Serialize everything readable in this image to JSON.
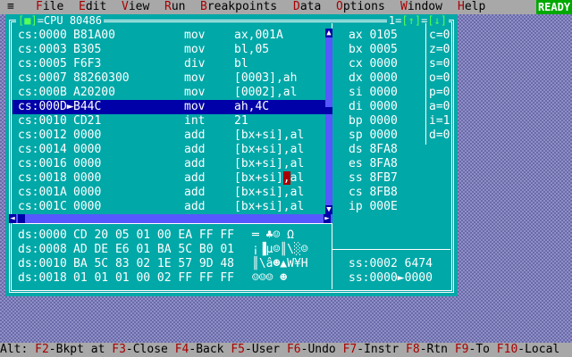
{
  "menubar": {
    "system_icon": "≡",
    "items": [
      {
        "hotkey": "F",
        "rest": "ile"
      },
      {
        "hotkey": "E",
        "rest": "dit"
      },
      {
        "hotkey": "V",
        "rest": "iew"
      },
      {
        "hotkey": "R",
        "rest": "un"
      },
      {
        "hotkey": "B",
        "rest": "reakpoints"
      },
      {
        "hotkey": "D",
        "rest": "ata"
      },
      {
        "hotkey": "O",
        "rest": "ptions"
      },
      {
        "hotkey": "W",
        "rest": "indow"
      },
      {
        "hotkey": "H",
        "rest": "elp"
      }
    ],
    "status": "READY"
  },
  "window": {
    "close_button": "[■]",
    "title": "CPU 80486",
    "number": "1",
    "zoom_button": "[↑]",
    "resize_button": "[↓]"
  },
  "disassembly": [
    {
      "addr": "cs:0000",
      "bytes": "B81A00",
      "mnemonic": "mov",
      "operands": "ax,001A"
    },
    {
      "addr": "cs:0003",
      "bytes": "B305",
      "mnemonic": "mov",
      "operands": "bl,05"
    },
    {
      "addr": "cs:0005",
      "bytes": "F6F3",
      "mnemonic": "div",
      "operands": "bl"
    },
    {
      "addr": "cs:0007",
      "bytes": "88260300",
      "mnemonic": "mov",
      "operands": "[0003],ah"
    },
    {
      "addr": "cs:000B",
      "bytes": "A20200",
      "mnemonic": "mov",
      "operands": "[0002],al"
    },
    {
      "addr": "cs:000D",
      "bytes": "B44C",
      "mnemonic": "mov",
      "operands": "ah,4C",
      "marker": "►",
      "selected": true
    },
    {
      "addr": "cs:0010",
      "bytes": "CD21",
      "mnemonic": "int",
      "operands": "21"
    },
    {
      "addr": "cs:0012",
      "bytes": "0000",
      "mnemonic": "add",
      "operands": "[bx+si],al"
    },
    {
      "addr": "cs:0014",
      "bytes": "0000",
      "mnemonic": "add",
      "operands": "[bx+si],al"
    },
    {
      "addr": "cs:0016",
      "bytes": "0000",
      "mnemonic": "add",
      "operands": "[bx+si],al"
    },
    {
      "addr": "cs:0018",
      "bytes": "0000",
      "mnemonic": "add",
      "operands_before": "[bx+si]",
      "cursor_char": ",",
      "operands_after": "al"
    },
    {
      "addr": "cs:001A",
      "bytes": "0000",
      "mnemonic": "add",
      "operands": "[bx+si],al"
    },
    {
      "addr": "cs:001C",
      "bytes": "0000",
      "mnemonic": "add",
      "operands": "[bx+si],al"
    }
  ],
  "registers": [
    {
      "name": "ax",
      "value": "0105"
    },
    {
      "name": "bx",
      "value": "0005"
    },
    {
      "name": "cx",
      "value": "0000"
    },
    {
      "name": "dx",
      "value": "0000"
    },
    {
      "name": "si",
      "value": "0000"
    },
    {
      "name": "di",
      "value": "0000"
    },
    {
      "name": "bp",
      "value": "0000"
    },
    {
      "name": "sp",
      "value": "0000"
    },
    {
      "name": "ds",
      "value": "8FA8"
    },
    {
      "name": "es",
      "value": "8FA8"
    },
    {
      "name": "ss",
      "value": "8FB7"
    },
    {
      "name": "cs",
      "value": "8FB8"
    },
    {
      "name": "ip",
      "value": "000E"
    }
  ],
  "flags": [
    {
      "name": "c",
      "value": "0"
    },
    {
      "name": "z",
      "value": "0"
    },
    {
      "name": "s",
      "value": "0"
    },
    {
      "name": "o",
      "value": "0"
    },
    {
      "name": "p",
      "value": "0"
    },
    {
      "name": "a",
      "value": "0"
    },
    {
      "name": "i",
      "value": "1"
    },
    {
      "name": "d",
      "value": "0"
    }
  ],
  "dump": [
    {
      "addr": "ds:0000",
      "bytes": "CD 20 05 01 00 EA FF FF",
      "ascii": "═ ♣☺ Ω  "
    },
    {
      "addr": "ds:0008",
      "bytes": "AD DE E6 01 BA 5C B0 01",
      "ascii": "¡▐µ☺║\\░☺"
    },
    {
      "addr": "ds:0010",
      "bytes": "BA 5C 83 02 1E 57 9D 48",
      "ascii": "║\\â☻▲W¥H"
    },
    {
      "addr": "ds:0018",
      "bytes": "01 01 01 00 02 FF FF FF",
      "ascii": "☺☺☺ ☻   "
    }
  ],
  "stack": [
    {
      "addr": "ss:0002",
      "marker": " ",
      "value": "6474"
    },
    {
      "addr": "ss:0000",
      "marker": "►",
      "value": "0000"
    }
  ],
  "statusbar": {
    "prefix": "Alt:",
    "items": [
      {
        "key": "F2",
        "label": "Bkpt at"
      },
      {
        "key": "F3",
        "label": "Close"
      },
      {
        "key": "F4",
        "label": "Back"
      },
      {
        "key": "F5",
        "label": "User"
      },
      {
        "key": "F6",
        "label": "Undo"
      },
      {
        "key": "F7",
        "label": "Instr"
      },
      {
        "key": "F8",
        "label": "Rtn"
      },
      {
        "key": "F9",
        "label": "To"
      },
      {
        "key": "F10",
        "label": "Local"
      }
    ]
  }
}
